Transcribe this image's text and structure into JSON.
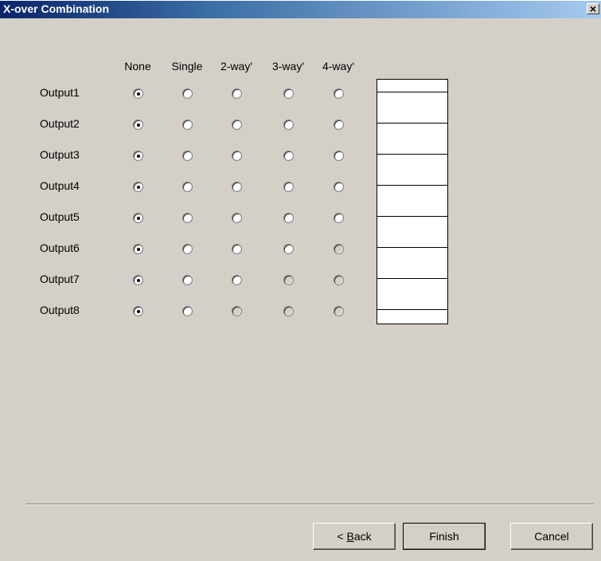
{
  "window": {
    "title": "X-over Combination",
    "close_label": "×"
  },
  "columns": [
    "None",
    "Single",
    "2-way'",
    "3-way'",
    "4-way'"
  ],
  "rows": [
    {
      "label": "Output1",
      "selected": 0,
      "enabled": [
        true,
        true,
        true,
        true,
        true
      ]
    },
    {
      "label": "Output2",
      "selected": 0,
      "enabled": [
        true,
        true,
        true,
        true,
        true
      ]
    },
    {
      "label": "Output3",
      "selected": 0,
      "enabled": [
        true,
        true,
        true,
        true,
        true
      ]
    },
    {
      "label": "Output4",
      "selected": 0,
      "enabled": [
        true,
        true,
        true,
        true,
        true
      ]
    },
    {
      "label": "Output5",
      "selected": 0,
      "enabled": [
        true,
        true,
        true,
        true,
        true
      ]
    },
    {
      "label": "Output6",
      "selected": 0,
      "enabled": [
        true,
        true,
        true,
        true,
        false
      ]
    },
    {
      "label": "Output7",
      "selected": 0,
      "enabled": [
        true,
        true,
        true,
        false,
        false
      ]
    },
    {
      "label": "Output8",
      "selected": 0,
      "enabled": [
        true,
        true,
        false,
        false,
        false
      ]
    }
  ],
  "buttons": {
    "back_prefix": "< ",
    "back_mnemonic": "B",
    "back_rest": "ack",
    "finish": "Finish",
    "cancel": "Cancel"
  }
}
